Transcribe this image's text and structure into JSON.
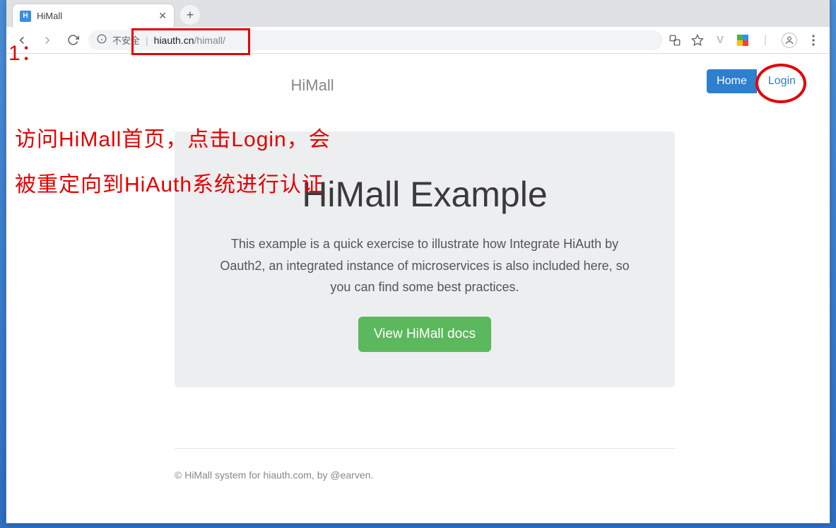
{
  "window": {
    "tab_title": "HiMall",
    "favicon_letter": "H"
  },
  "omnibox": {
    "insecure_label": "不安全",
    "host": "hiauth.cn",
    "path": "/himall/"
  },
  "site": {
    "brand": "HiMall",
    "nav_home": "Home",
    "nav_login": "Login"
  },
  "jumbotron": {
    "title": "HiMall Example",
    "text": "This example is a quick exercise to illustrate how Integrate HiAuth by Oauth2, an integrated instance of microservices is also included here, so you can find some best practices.",
    "button": "View HiMall docs"
  },
  "footer": {
    "text": "© HiMall system for hiauth.com, by @earven."
  },
  "annotations": {
    "step_marker": "1：",
    "line1": "访问HiMall首页，点击Login，会",
    "line2": "被重定向到HiAuth系统进行认证"
  }
}
